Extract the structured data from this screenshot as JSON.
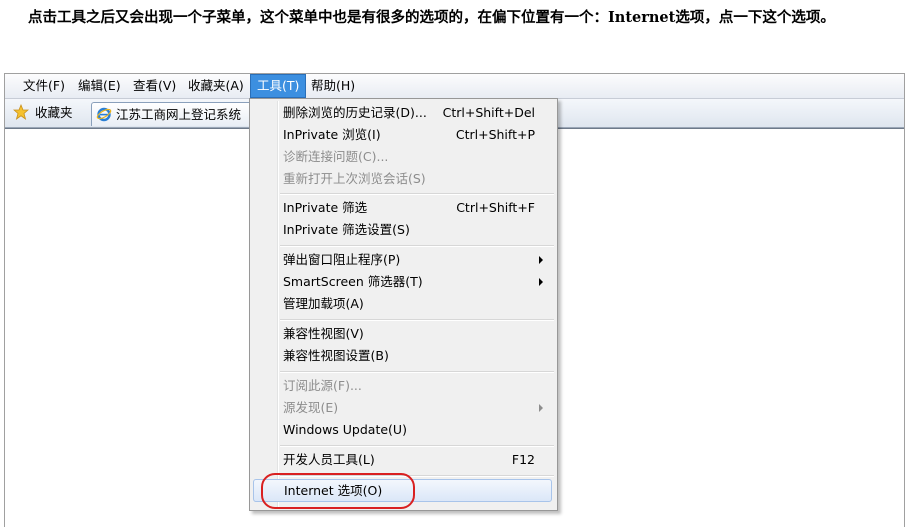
{
  "intro": {
    "text": "点击工具之后又会出现一个子菜单，这个菜单中也是有很多的选项的，在偏下位置有一个：Internet选项，点一下这个选项。"
  },
  "menubar": {
    "items": [
      {
        "label": "文件(F)"
      },
      {
        "label": "编辑(E)"
      },
      {
        "label": "查看(V)"
      },
      {
        "label": "收藏夹(A)"
      },
      {
        "label": "工具(T)",
        "active": true
      },
      {
        "label": "帮助(H)"
      }
    ]
  },
  "favbar": {
    "favorites_label": "收藏夹",
    "favorites_icon": "star-icon",
    "tab_title": "江苏工商网上登记系统",
    "tab_icon": "ie-icon"
  },
  "tools_menu": {
    "items": [
      {
        "label": "删除浏览的历史记录(D)...",
        "shortcut": "Ctrl+Shift+Del"
      },
      {
        "label": "InPrivate 浏览(I)",
        "shortcut": "Ctrl+Shift+P"
      },
      {
        "label": "诊断连接问题(C)...",
        "disabled": true
      },
      {
        "label": "重新打开上次浏览会话(S)",
        "disabled": true
      },
      {
        "label": "InPrivate 筛选",
        "shortcut": "Ctrl+Shift+F"
      },
      {
        "label": "InPrivate 筛选设置(S)"
      },
      {
        "label": "弹出窗口阻止程序(P)",
        "submenu": true
      },
      {
        "label": "SmartScreen 筛选器(T)",
        "submenu": true
      },
      {
        "label": "管理加载项(A)"
      },
      {
        "label": "兼容性视图(V)"
      },
      {
        "label": "兼容性视图设置(B)"
      },
      {
        "label": "订阅此源(F)...",
        "disabled": true
      },
      {
        "label": "源发现(E)",
        "disabled": true,
        "submenu": true
      },
      {
        "label": "Windows Update(U)"
      },
      {
        "label": "开发人员工具(L)",
        "shortcut": "F12"
      },
      {
        "label": "Internet 选项(O)",
        "highlighted": true
      }
    ]
  },
  "colors": {
    "active_menu": "#3c8fe0",
    "annotation_ring": "#d92020"
  }
}
